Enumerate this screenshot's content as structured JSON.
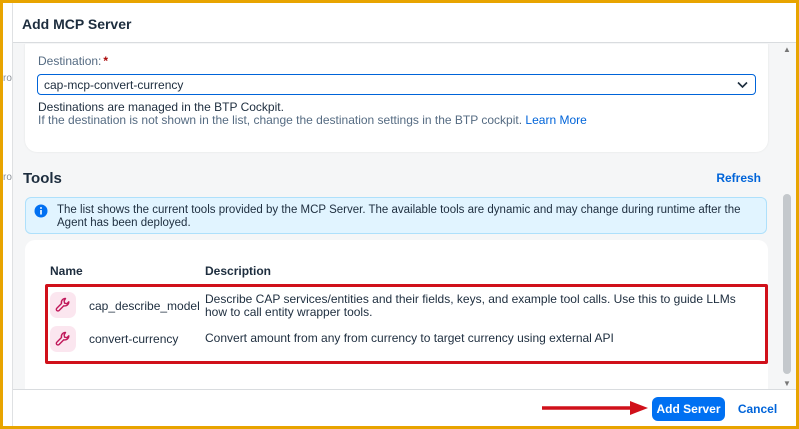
{
  "background_page": {
    "side_text": "ro"
  },
  "dialog": {
    "title": "Add MCP Server"
  },
  "destination": {
    "label": "Destination:",
    "required_mark": "*",
    "selected_value": "cap-mcp-convert-currency",
    "info_line1": "Destinations are managed in the BTP Cockpit.",
    "info_line2": "If the destination is not shown in the list, change the destination settings in the BTP cockpit.",
    "learn_more": "Learn More"
  },
  "tools": {
    "title": "Tools",
    "refresh_label": "Refresh",
    "info_message": "The list shows the current tools provided by the MCP Server. The available tools are dynamic and may change during runtime after the Agent has been deployed.",
    "columns": {
      "name": "Name",
      "description": "Description"
    },
    "rows": [
      {
        "name": "cap_describe_model",
        "description": "Describe CAP services/entities and their fields, keys, and example tool calls. Use this to guide LLMs how to call entity wrapper tools."
      },
      {
        "name": "convert-currency",
        "description": "Convert amount from any from currency to target currency using external API"
      }
    ]
  },
  "footer": {
    "add_server_label": "Add Server",
    "cancel_label": "Cancel"
  },
  "colors": {
    "accent": "#0070f2",
    "annotation_red": "#d0101a",
    "frame_border": "#e8a400"
  }
}
